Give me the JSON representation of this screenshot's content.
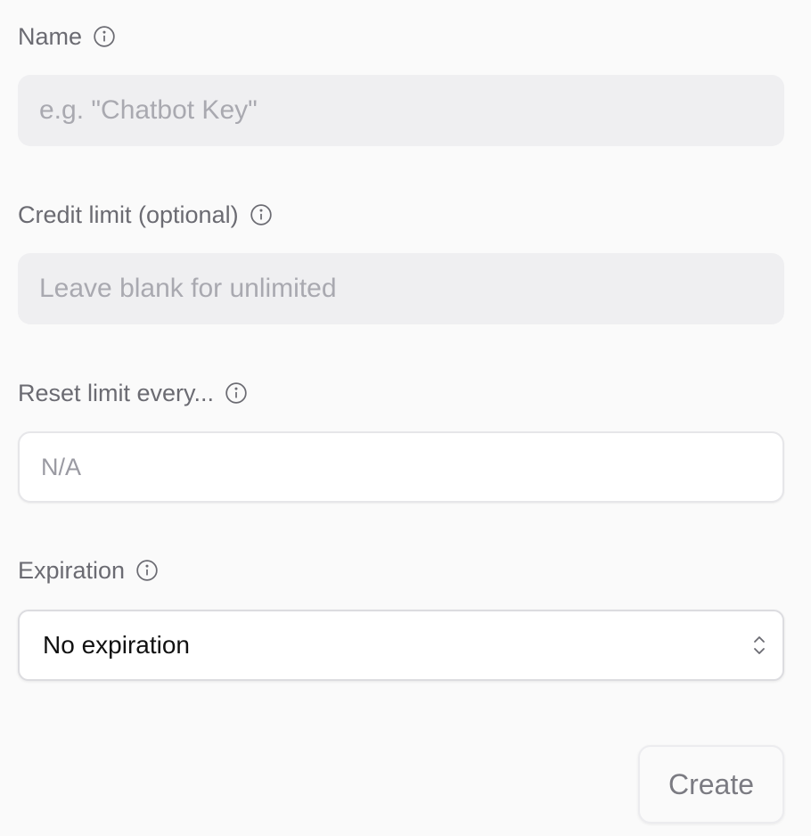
{
  "form": {
    "name": {
      "label": "Name",
      "placeholder": "e.g. \"Chatbot Key\"",
      "value": ""
    },
    "credit_limit": {
      "label": "Credit limit (optional)",
      "placeholder": "Leave blank for unlimited",
      "value": ""
    },
    "reset_limit": {
      "label": "Reset limit every...",
      "placeholder": "N/A",
      "value": ""
    },
    "expiration": {
      "label": "Expiration",
      "selected": "No expiration"
    },
    "create_label": "Create"
  },
  "icons": {
    "info": "info-circle-icon",
    "select_chevron": "chevron-up-down-icon"
  },
  "colors": {
    "label": "#6b6b72",
    "input_fill": "#efeff1",
    "placeholder": "#a9a9b0",
    "button_text": "#7b7b82"
  }
}
